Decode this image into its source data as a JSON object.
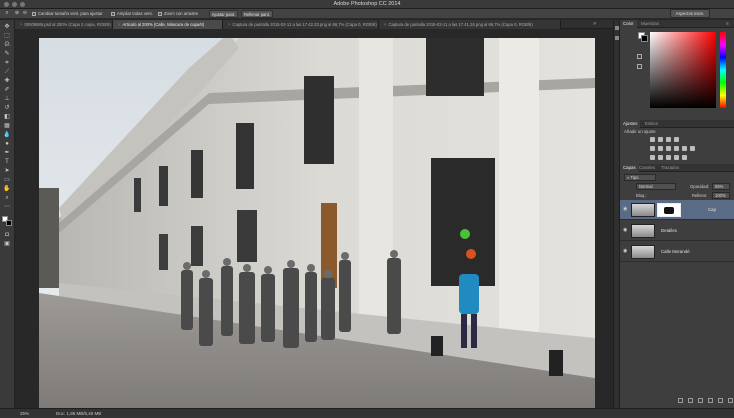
{
  "app": {
    "title": "Adobe Photoshop CC 2014",
    "workspace_button": "Aspectos esen."
  },
  "options_bar": {
    "resize_windows": "Cambiar tamaño vent. para ajustar",
    "zoom_all_windows": "Ampliar todas vent.",
    "scrubby_zoom": "Zoom con arrastre",
    "fit_screen": "Ajustar pant.",
    "fill_screen": "Rellenar pant."
  },
  "tabs": [
    {
      "label": "00006686.psd al 200% (Capa 2 copia, RGB/8)",
      "active": false
    },
    {
      "label": "Articulo al 200% (Calle, Máscara de capa/8)",
      "active": true
    },
    {
      "label": "Captura de pantalla 2015-02-11 a las 17.42.23.png al 66,7% (Capa 0, RGB/8)",
      "active": false
    },
    {
      "label": "Captura de pantalla 2015-02-11 a las 17.41.34.png al 66,7% (Capa 0, RGB/8)",
      "active": false
    }
  ],
  "status": {
    "zoom": "25%",
    "doc": "Doc: 1,95 MB/5,45 MB"
  },
  "color_panel": {
    "tabs": [
      "Color",
      "Muestras"
    ],
    "foreground": "#ffffff",
    "background": "#000000",
    "hue": "#ff0000"
  },
  "adjustments_panel": {
    "tabs": [
      "Ajustes",
      "Estilos"
    ],
    "label": "Añadir un ajuste"
  },
  "layers_panel": {
    "tabs": [
      "Capas",
      "Canales",
      "Trazados"
    ],
    "filter": "Tipo",
    "blend_mode": "Normal",
    "opacity_label": "Opacidad:",
    "opacity": "85%",
    "lock_label": "Bloq.:",
    "fill_label": "Relleno:",
    "fill": "100%",
    "layers": [
      {
        "name": "Cap",
        "selected": true,
        "mask": true
      },
      {
        "name": "Detalles",
        "selected": false,
        "mask": false
      },
      {
        "name": "Calle Morandé",
        "selected": false,
        "mask": false
      }
    ]
  }
}
